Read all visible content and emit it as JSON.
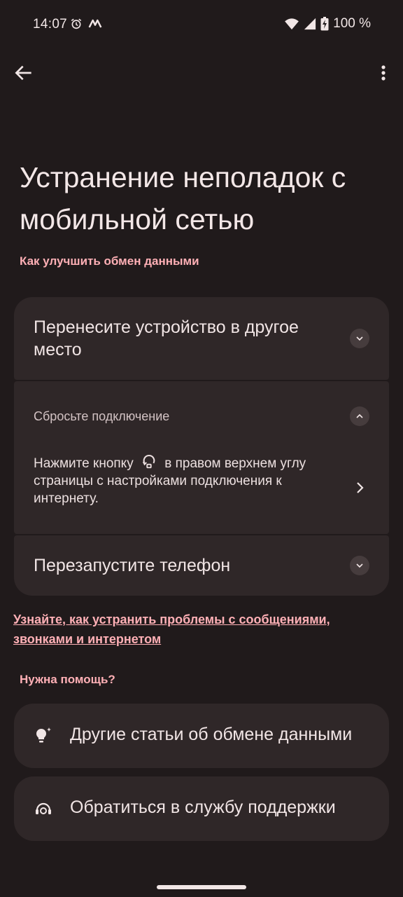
{
  "status_bar": {
    "time": "14:07",
    "battery": "100 %",
    "icons": [
      "alarm-icon",
      "notification-m-icon",
      "wifi-icon",
      "signal-icon",
      "battery-charging-icon"
    ]
  },
  "toolbar": {
    "back_icon": "arrow-back-icon",
    "menu_icon": "more-vert-icon"
  },
  "page": {
    "title": "Устранение неполадок с мобильной сетью"
  },
  "section_tips": {
    "label": "Как улучшить обмен данными",
    "items": [
      {
        "title": "Перенесите устройство в другое место",
        "expanded": false
      },
      {
        "title": "Сбросьте подключение",
        "expanded": true,
        "body_before_icon": "Нажмите кнопку",
        "body_after_icon": "в правом верхнем углу страницы с настройками подключения к интернету.",
        "inline_icon": "reset-connection-icon"
      },
      {
        "title": "Перезапустите телефон",
        "expanded": false
      }
    ]
  },
  "help_link": "Узнайте, как устранить проблемы с сообщениями, звонками и интернетом",
  "section_help": {
    "label": "Нужна помощь?",
    "items": [
      {
        "label": "Другие статьи об обмене данными",
        "icon": "lightbulb-icon"
      },
      {
        "label": "Обратиться в службу поддержки",
        "icon": "support-agent-icon"
      }
    ]
  },
  "colors": {
    "background": "#201a1b",
    "card": "#2f2728",
    "accent": "#ffb0b6",
    "text": "#f1e5e5"
  }
}
